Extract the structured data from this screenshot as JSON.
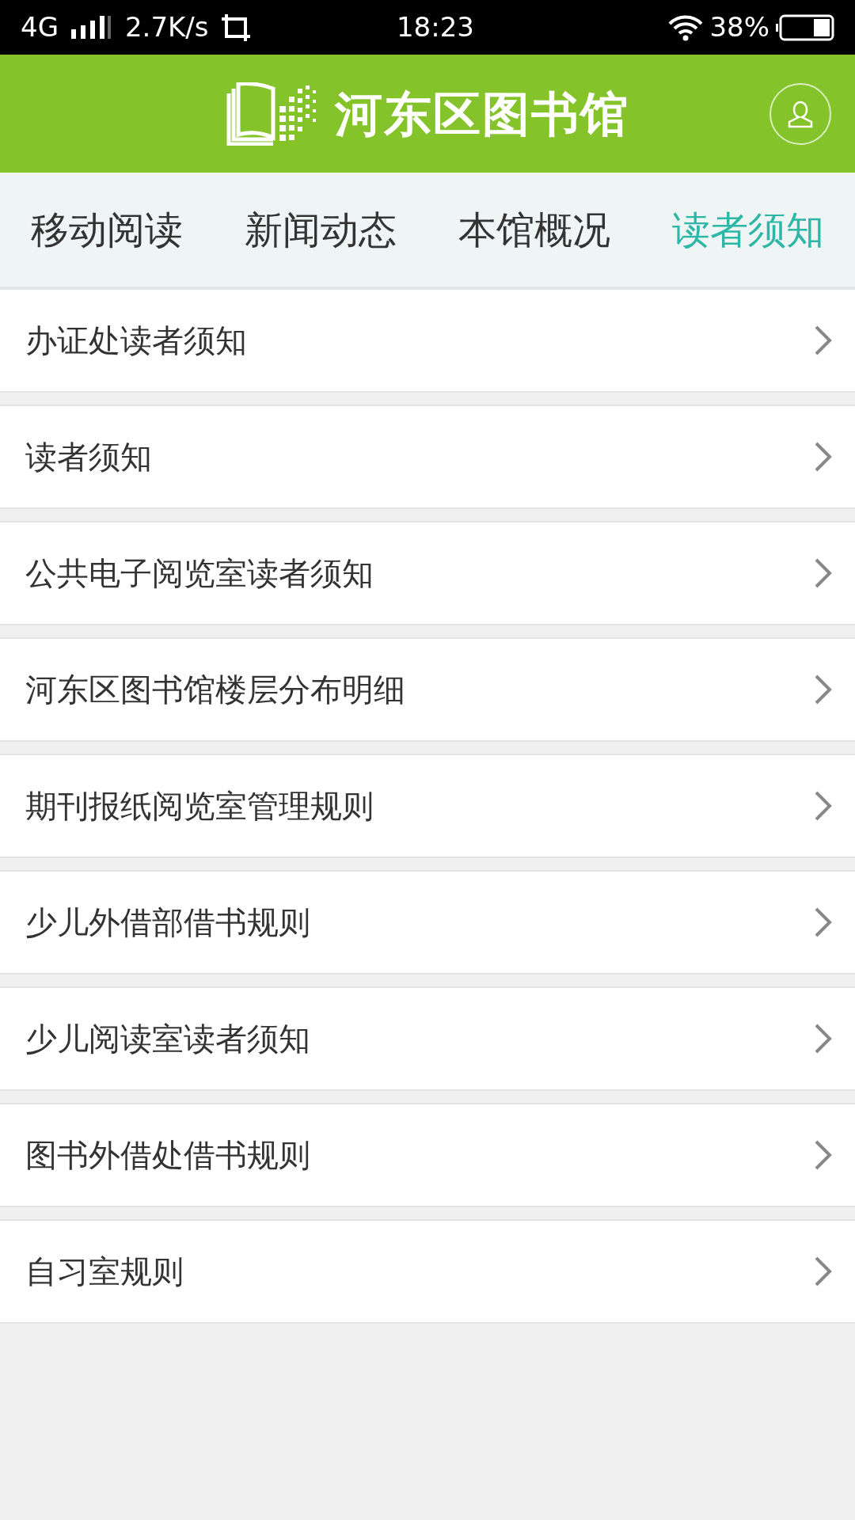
{
  "status_bar": {
    "network": "4G",
    "speed": "2.7K/s",
    "time": "18:23",
    "battery": "38%"
  },
  "header": {
    "title": "河东区图书馆"
  },
  "tabs": [
    {
      "label": "移动阅读",
      "selected": false
    },
    {
      "label": "新闻动态",
      "selected": false
    },
    {
      "label": "本馆概况",
      "selected": false
    },
    {
      "label": "读者须知",
      "selected": true
    }
  ],
  "items": [
    {
      "label": "办证处读者须知"
    },
    {
      "label": "读者须知"
    },
    {
      "label": "公共电子阅览室读者须知"
    },
    {
      "label": "河东区图书馆楼层分布明细"
    },
    {
      "label": "期刊报纸阅览室管理规则"
    },
    {
      "label": "少儿外借部借书规则"
    },
    {
      "label": "少儿阅读室读者须知"
    },
    {
      "label": "图书外借处借书规则"
    },
    {
      "label": "自习室规则"
    }
  ]
}
